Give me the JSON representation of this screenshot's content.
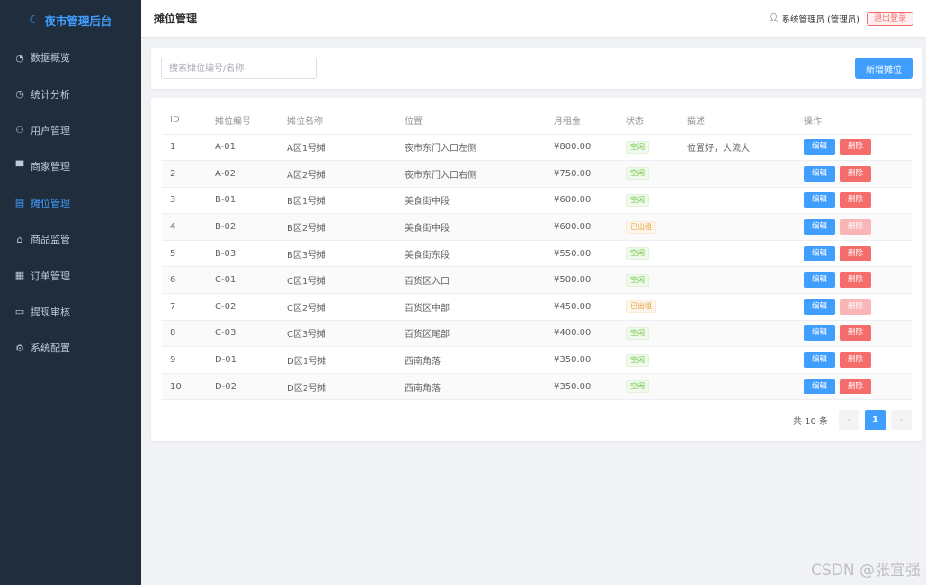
{
  "sidebar": {
    "brand": "夜市管理后台",
    "items": [
      {
        "label": "数据概览",
        "icon": "◔"
      },
      {
        "label": "统计分析",
        "icon": "◷"
      },
      {
        "label": "用户管理",
        "icon": "⚇"
      },
      {
        "label": "商家管理",
        "icon": "▀"
      },
      {
        "label": "摊位管理",
        "icon": "▤"
      },
      {
        "label": "商品监管",
        "icon": "⌂"
      },
      {
        "label": "订单管理",
        "icon": "▦"
      },
      {
        "label": "提现审核",
        "icon": "▭"
      },
      {
        "label": "系统配置",
        "icon": "⚙"
      }
    ],
    "active_index": 4
  },
  "header": {
    "title": "摊位管理",
    "user": "系统管理员 (管理员)",
    "logout": "退出登录"
  },
  "search": {
    "placeholder": "搜索摊位编号/名称",
    "add_label": "新增摊位"
  },
  "table": {
    "columns": [
      "ID",
      "摊位编号",
      "摊位名称",
      "位置",
      "月租金",
      "状态",
      "描述",
      "操作"
    ],
    "edit_label": "编辑",
    "delete_label": "删除",
    "rows": [
      {
        "id": "1",
        "code": "A-01",
        "name": "A区1号摊",
        "location": "夜市东门入口左侧",
        "rent": "¥800.00",
        "status": "空闲",
        "desc": "位置好，人流大"
      },
      {
        "id": "2",
        "code": "A-02",
        "name": "A区2号摊",
        "location": "夜市东门入口右侧",
        "rent": "¥750.00",
        "status": "空闲",
        "desc": ""
      },
      {
        "id": "3",
        "code": "B-01",
        "name": "B区1号摊",
        "location": "美食街中段",
        "rent": "¥600.00",
        "status": "空闲",
        "desc": ""
      },
      {
        "id": "4",
        "code": "B-02",
        "name": "B区2号摊",
        "location": "美食街中段",
        "rent": "¥600.00",
        "status": "已出租",
        "desc": ""
      },
      {
        "id": "5",
        "code": "B-03",
        "name": "B区3号摊",
        "location": "美食街东段",
        "rent": "¥550.00",
        "status": "空闲",
        "desc": ""
      },
      {
        "id": "6",
        "code": "C-01",
        "name": "C区1号摊",
        "location": "百货区入口",
        "rent": "¥500.00",
        "status": "空闲",
        "desc": ""
      },
      {
        "id": "7",
        "code": "C-02",
        "name": "C区2号摊",
        "location": "百货区中部",
        "rent": "¥450.00",
        "status": "已出租",
        "desc": ""
      },
      {
        "id": "8",
        "code": "C-03",
        "name": "C区3号摊",
        "location": "百货区尾部",
        "rent": "¥400.00",
        "status": "空闲",
        "desc": ""
      },
      {
        "id": "9",
        "code": "D-01",
        "name": "D区1号摊",
        "location": "西南角落",
        "rent": "¥350.00",
        "status": "空闲",
        "desc": ""
      },
      {
        "id": "10",
        "code": "D-02",
        "name": "D区2号摊",
        "location": "西南角落",
        "rent": "¥350.00",
        "status": "空闲",
        "desc": ""
      }
    ]
  },
  "pagination": {
    "total": "共 10 条",
    "current": "1",
    "prev": "‹",
    "next": "›"
  },
  "watermark": "CSDN @张宜强",
  "colors": {
    "sidebar_bg": "#1f2d3d",
    "primary": "#409eff",
    "danger": "#f56c6c",
    "success": "#67c23a",
    "warning": "#e6a23c"
  }
}
